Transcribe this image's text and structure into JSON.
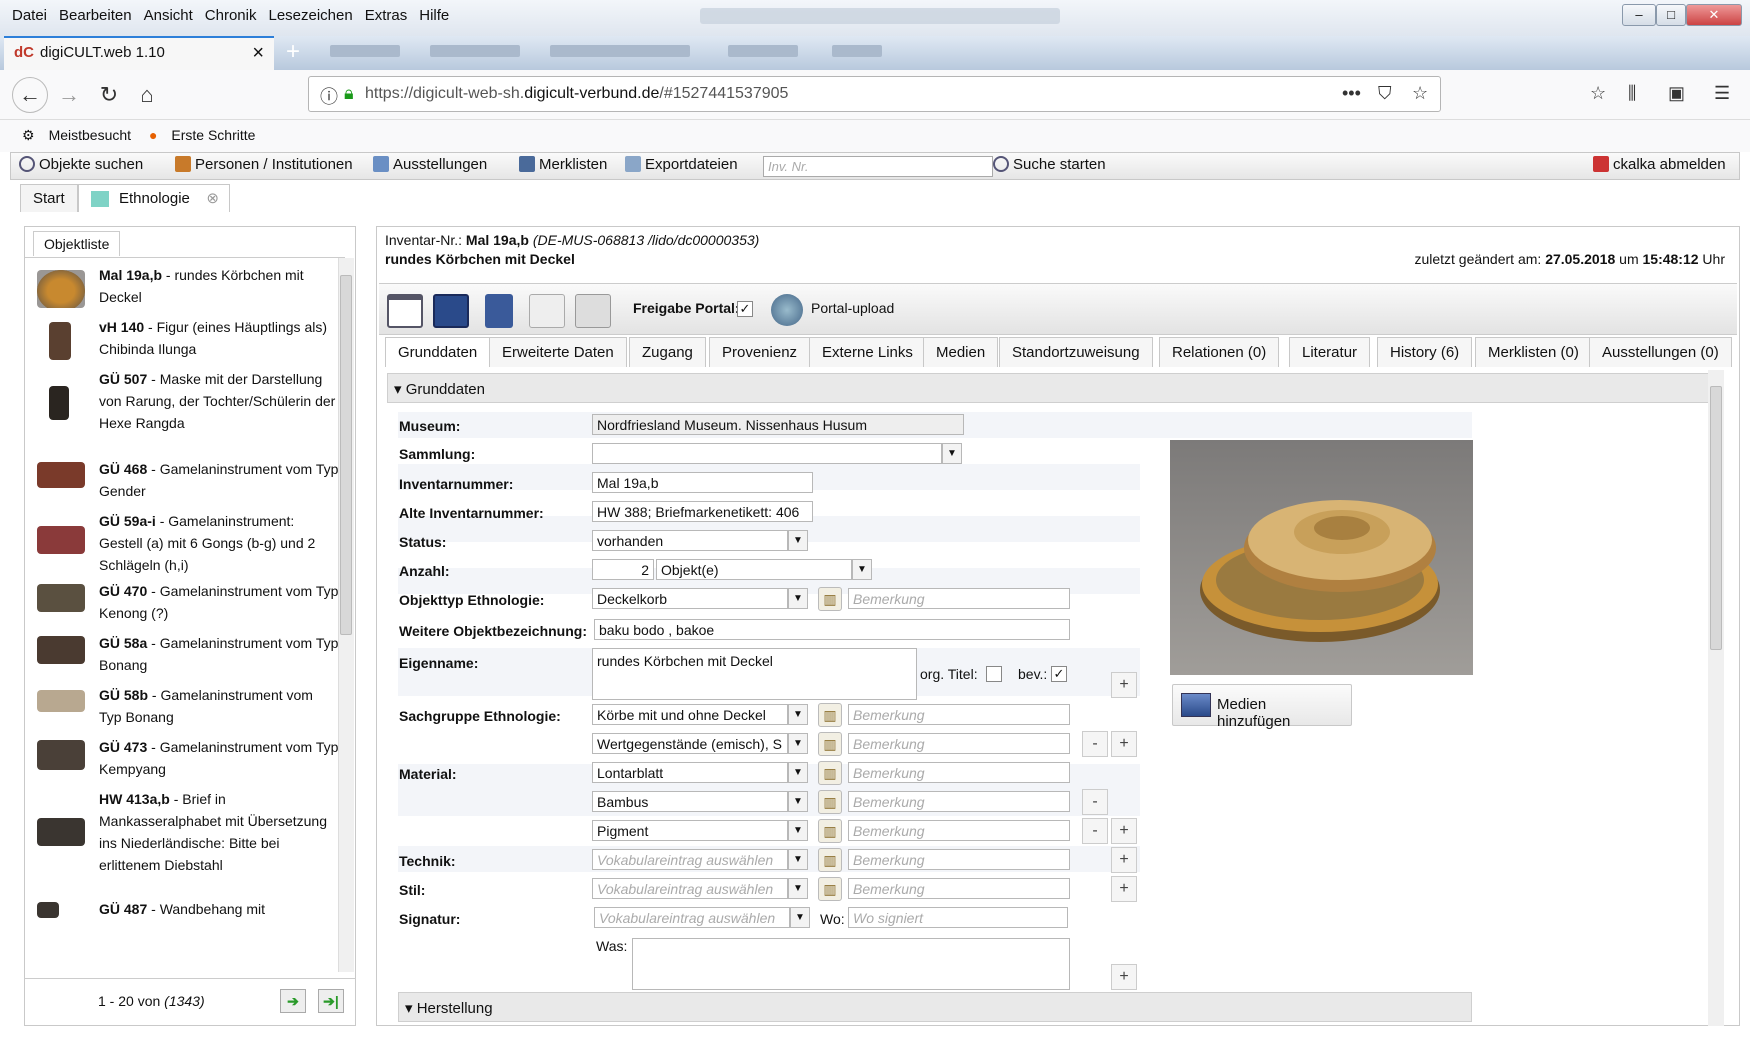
{
  "browser": {
    "menu": [
      "Datei",
      "Bearbeiten",
      "Ansicht",
      "Chronik",
      "Lesezeichen",
      "Extras",
      "Hilfe"
    ],
    "tab_logo": "dC",
    "tab_title": "digiCULT.web 1.10",
    "url_prefix": "https://digicult-web-sh.",
    "url_domain": "digicult-verbund.de",
    "url_suffix": "/#1527441537905",
    "bookmarks": [
      "Meistbesucht",
      "Erste Schritte"
    ]
  },
  "toolbar": {
    "objekte_suchen": "Objekte suchen",
    "personen": "Personen / Institutionen",
    "ausstellungen": "Ausstellungen",
    "merklisten": "Merklisten",
    "exportdateien": "Exportdateien",
    "inv_placeholder": "Inv. Nr.",
    "suche_starten": "Suche starten",
    "logout": "ckalka abmelden"
  },
  "app_tabs": [
    "Start",
    "Ethnologie"
  ],
  "objektliste": {
    "tab": "Objektliste",
    "items": [
      {
        "id": "Mal 19a,b",
        "desc": " - rundes Körbchen mit Deckel"
      },
      {
        "id": "vH 140",
        "desc": " - Figur (eines Häuptlings als) Chibinda Ilunga"
      },
      {
        "id": "GÜ 507",
        "desc": " - Maske mit der Darstellung von Rarung, der Tochter/Schülerin der Hexe Rangda"
      },
      {
        "id": "GÜ 468",
        "desc": " - Gamelaninstrument vom Typ Gender"
      },
      {
        "id": "GÜ 59a-i",
        "desc": " - Gamelaninstrument: Gestell (a) mit 6 Gongs (b-g) und 2 Schlägeln (h,i)"
      },
      {
        "id": "GÜ 470",
        "desc": " - Gamelaninstrument vom Typ Kenong (?)"
      },
      {
        "id": "GÜ 58a",
        "desc": " - Gamelaninstrument vom Typ Bonang"
      },
      {
        "id": "GÜ 58b",
        "desc": " - Gamelaninstrument vom Typ Bonang"
      },
      {
        "id": "GÜ 473",
        "desc": " - Gamelaninstrument vom Typ Kempyang"
      },
      {
        "id": "HW 413a,b",
        "desc": " - Brief in Mankasseralphabet mit Übersetzung ins Niederländische: Bitte bei erlittenem Diebstahl"
      },
      {
        "id": "GÜ 487",
        "desc": " - Wandbehang mit"
      }
    ],
    "pager_range": "1 - 20 von ",
    "pager_total": "(1343)"
  },
  "header": {
    "inv_label": "Inventar-Nr.: ",
    "inv_value": "Mal 19a,b",
    "inv_path": " (DE-MUS-068813 /lido/dc00000353)",
    "title": "rundes Körbchen mit Deckel",
    "changed_label": "zuletzt geändert am: ",
    "changed_date": "27.05.2018",
    "changed_um": " um ",
    "changed_time": "15:48:12",
    "changed_uhr": " Uhr"
  },
  "tools": {
    "freigabe_label": "Freigabe Portal:",
    "freigabe_checked": true,
    "portal_upload": "Portal-upload"
  },
  "subtabs": [
    "Grunddaten",
    "Erweiterte Daten",
    "Zugang",
    "Provenienz",
    "Externe Links",
    "Medien",
    "Standortzuweisung",
    "Relationen (0)",
    "Literatur",
    "History (6)",
    "Merklisten (0)",
    "Ausstellungen (0)"
  ],
  "section": "Grunddaten",
  "section2": "Herstellung",
  "form": {
    "museum_label": "Museum:",
    "museum_value": "Nordfriesland Museum. Nissenhaus Husum",
    "sammlung_label": "Sammlung:",
    "sammlung_value": "",
    "inventarnummer_label": "Inventarnummer:",
    "inventarnummer_value": "Mal 19a,b",
    "alte_label": "Alte Inventarnummer:",
    "alte_value": "HW 388; Briefmarkenetikett: 406",
    "status_label": "Status:",
    "status_value": "vorhanden",
    "anzahl_label": "Anzahl:",
    "anzahl_value": "2",
    "anzahl_unit": "Objekt(e)",
    "objekttyp_label": "Objekttyp Ethnologie:",
    "objekttyp_value": "Deckelkorb",
    "weitere_label": "Weitere Objektbezeichnung:",
    "weitere_value": "baku bodo , bakoe",
    "eigenname_label": "Eigenname:",
    "eigenname_value": "rundes Körbchen mit Deckel",
    "org_titel": "org. Titel:",
    "bev": "bev.:",
    "sachgruppe_label": "Sachgruppe Ethnologie:",
    "sachgruppe_1": "Körbe mit und ohne Deckel",
    "sachgruppe_2": "Wertgegenstände (emisch), S",
    "material_label": "Material:",
    "material_1": "Lontarblatt",
    "material_2": "Bambus",
    "material_3": "Pigment",
    "technik_label": "Technik:",
    "stil_label": "Stil:",
    "signatur_label": "Signatur:",
    "vokabular_placeholder": "Vokabulareintrag auswählen",
    "bemerkung_placeholder": "Bemerkung",
    "wo_label": "Wo:",
    "wo_placeholder": "Wo signiert",
    "was_label": "Was:"
  },
  "media_button": "Medien hinzufügen",
  "colors": {
    "tab_accent": "#2d7fd9",
    "ethno_tab": "#7fd3c6",
    "pager_green": "#2a9a2a"
  }
}
